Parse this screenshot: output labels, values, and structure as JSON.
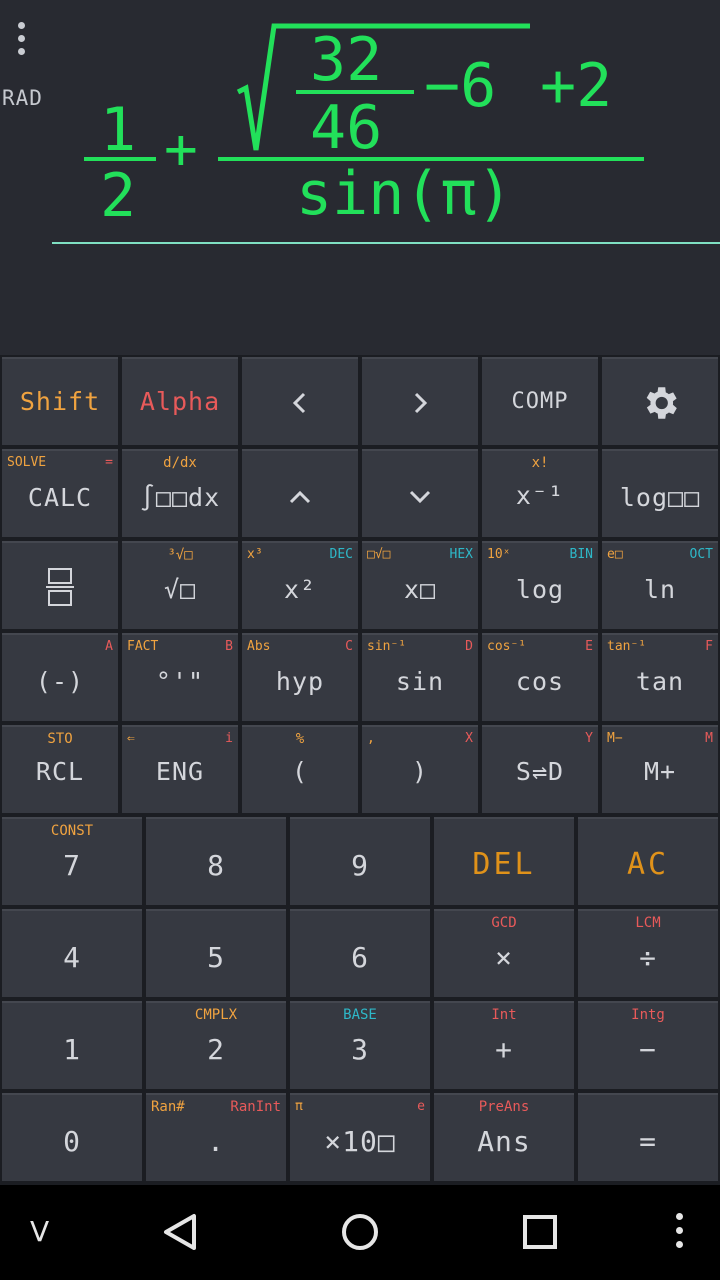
{
  "display": {
    "angle_mode": "RAD",
    "expression": {
      "frac_num": "1",
      "frac_den": "2",
      "plus1": "+",
      "root_num": "32",
      "root_den": "46",
      "minus6": "−6",
      "plus2": "+2",
      "denominator": "sin(π)"
    }
  },
  "keys": {
    "shift": "Shift",
    "alpha": "Alpha",
    "left": "<",
    "right": ">",
    "comp": "COMP",
    "calc": "CALC",
    "calc_shift": "SOLVE",
    "calc_alpha": "=",
    "integral": "∫□□dx",
    "integral_shift": "d/dx",
    "up": "^",
    "down": "⌄",
    "inverse": "x⁻¹",
    "inverse_shift": "x!",
    "logbase": "log□□",
    "fraction_shift": "",
    "sqrt": "√□",
    "sqrt_shift": "³√□",
    "square": "x²",
    "square_shift": "x³",
    "square_alpha": "DEC",
    "power": "x□",
    "power_shift": "□√□",
    "power_alpha": "HEX",
    "log": "log",
    "log_shift": "10ˣ",
    "log_alpha": "BIN",
    "ln": "ln",
    "ln_shift": "e□",
    "ln_alpha": "OCT",
    "neg": "(-)",
    "neg_alpha": "A",
    "dms": "°'\"",
    "dms_shift": "FACT",
    "dms_alpha": "B",
    "hyp": "hyp",
    "hyp_shift": "Abs",
    "hyp_alpha": "C",
    "sin": "sin",
    "sin_shift": "sin⁻¹",
    "sin_alpha": "D",
    "cos": "cos",
    "cos_shift": "cos⁻¹",
    "cos_alpha": "E",
    "tan": "tan",
    "tan_shift": "tan⁻¹",
    "tan_alpha": "F",
    "rcl": "RCL",
    "rcl_shift": "STO",
    "eng": "ENG",
    "eng_shift": "⇐",
    "eng_alpha": "i",
    "lparen": "(",
    "lparen_shift": "%",
    "rparen": ")",
    "rparen_shift": ",",
    "rparen_alpha": "X",
    "sd": "S⇌D",
    "sd_alpha": "Y",
    "mplus": "M+",
    "mplus_shift": "M−",
    "mplus_alpha": "M",
    "n7": "7",
    "n7_shift": "CONST",
    "n8": "8",
    "n9": "9",
    "del": "DEL",
    "ac": "AC",
    "n4": "4",
    "n5": "5",
    "n6": "6",
    "mul": "×",
    "mul_shift": "GCD",
    "div": "÷",
    "div_shift": "LCM",
    "n1": "1",
    "n2": "2",
    "n2_shift": "CMPLX",
    "n3": "3",
    "n3_shift": "BASE",
    "plus": "+",
    "plus_shift": "Int",
    "minus": "−",
    "minus_shift": "Intg",
    "n0": "0",
    "dot": ".",
    "dot_shift": "Ran#",
    "dot_alpha": "RanInt",
    "exp": "×10□",
    "exp_shift": "π",
    "exp_alpha": "e",
    "ans": "Ans",
    "ans_shift": "PreAns",
    "eq": "="
  },
  "navbar": {
    "collapse": "V"
  },
  "colors": {
    "expression": "#22e05a",
    "shift": "#f0a340",
    "alpha": "#e85a5a",
    "base": "#2eb8c8",
    "key_bg": "#363941"
  }
}
